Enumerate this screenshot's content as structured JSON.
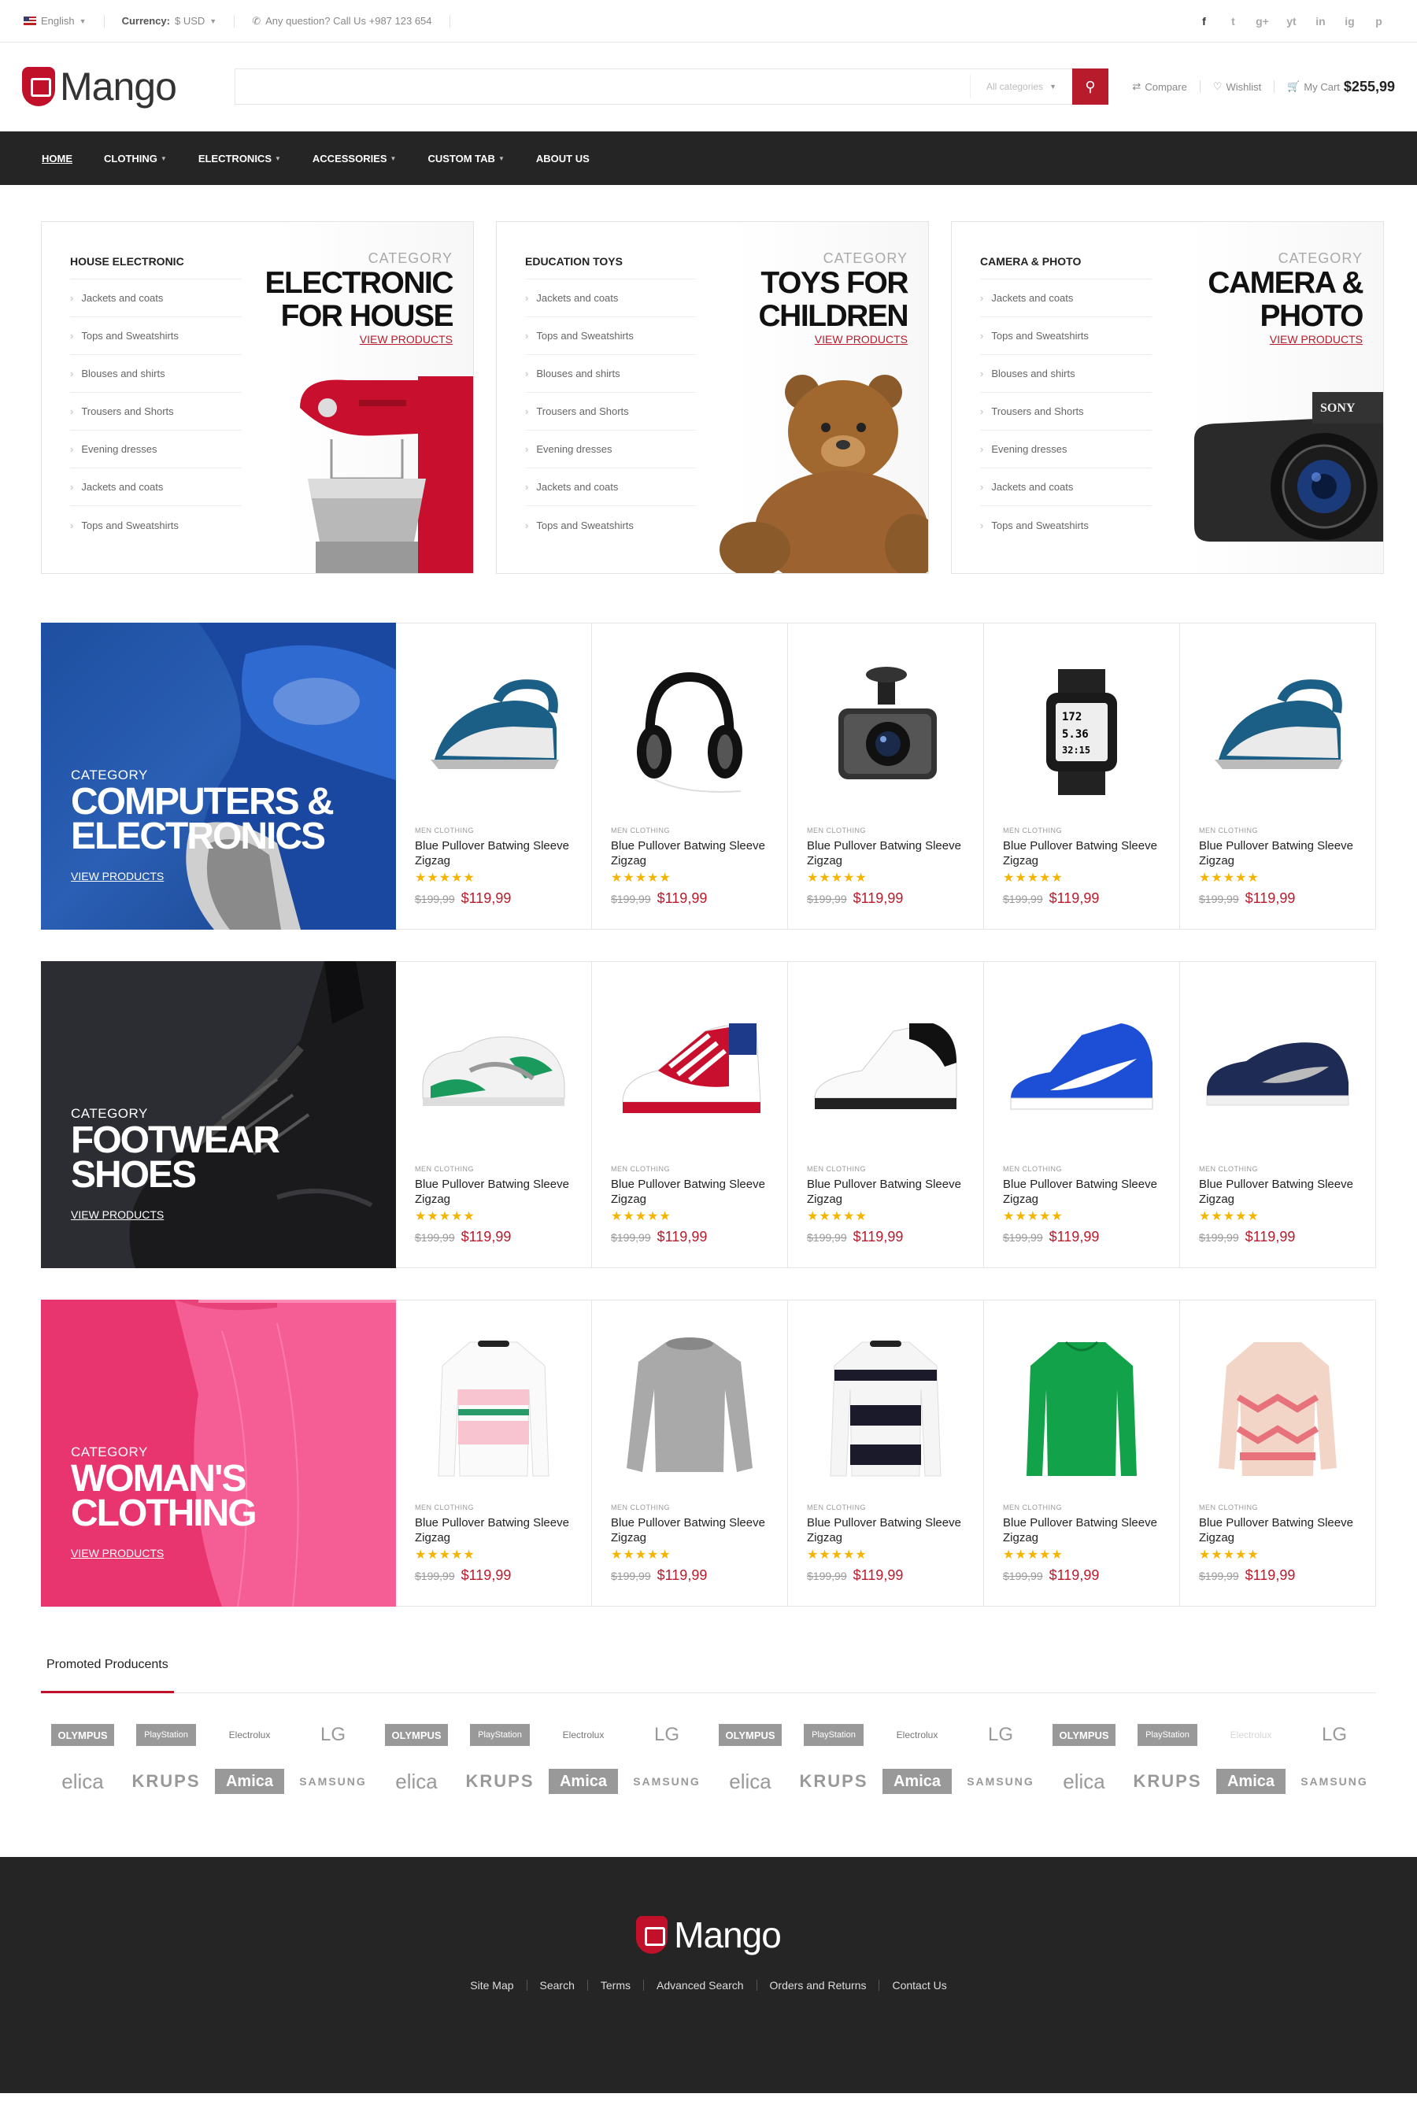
{
  "topbar": {
    "language": "English",
    "currency_label": "Currency:",
    "currency_value": "$ USD",
    "contact": "Any question? Call Us +987 123 654",
    "socials": [
      "f",
      "t",
      "g+",
      "yt",
      "in",
      "ig",
      "p"
    ]
  },
  "header": {
    "logo": "Mango",
    "search_placeholder": "",
    "category_select": "All categories",
    "compare": "Compare",
    "wishlist": "Wishlist",
    "cart_label": "My Cart",
    "cart_total": "$255,99"
  },
  "nav": [
    "HOME",
    "CLOTHING",
    "ELECTRONICS",
    "ACCESSORIES",
    "CUSTOM TAB",
    "ABOUT US"
  ],
  "category_boxes": [
    {
      "heading": "HOUSE ELECTRONIC",
      "label": "CATEGORY",
      "title": "ELECTRONIC FOR HOUSE",
      "link": "VIEW PRODUCTS",
      "items": [
        "Jackets and coats",
        "Tops and Sweatshirts",
        "Blouses and shirts",
        "Trousers and Shorts",
        "Evening dresses",
        "Jackets and coats",
        "Tops and Sweatshirts"
      ]
    },
    {
      "heading": "EDUCATION TOYS",
      "label": "CATEGORY",
      "title": "TOYS FOR CHILDREN",
      "link": "VIEW PRODUCTS",
      "items": [
        "Jackets and coats",
        "Tops and Sweatshirts",
        "Blouses and shirts",
        "Trousers and Shorts",
        "Evening dresses",
        "Jackets and coats",
        "Tops and Sweatshirts"
      ]
    },
    {
      "heading": "CAMERA & PHOTO",
      "label": "CATEGORY",
      "title": "CAMERA & PHOTO",
      "link": "VIEW PRODUCTS",
      "items": [
        "Jackets and coats",
        "Tops and Sweatshirts",
        "Blouses and shirts",
        "Trousers and Shorts",
        "Evening dresses",
        "Jackets and coats",
        "Tops and Sweatshirts"
      ]
    }
  ],
  "rows": [
    {
      "label": "CATEGORY",
      "title": "COMPUTERS & ELECTRONICS",
      "link": "VIEW PRODUCTS",
      "color": "#1e4fa0",
      "products": [
        {
          "cat": "MEN CLOTHING",
          "name": "Blue Pullover Batwing Sleeve Zigzag",
          "stars": "★★★★★",
          "old": "$199,99",
          "price": "$119,99",
          "icon": "iron"
        },
        {
          "cat": "MEN CLOTHING",
          "name": "Blue Pullover Batwing Sleeve Zigzag",
          "stars": "★★★★★",
          "old": "$199,99",
          "price": "$119,99",
          "icon": "headphones"
        },
        {
          "cat": "MEN CLOTHING",
          "name": "Blue Pullover Batwing Sleeve Zigzag",
          "stars": "★★★★★",
          "old": "$199,99",
          "price": "$119,99",
          "icon": "dashcam"
        },
        {
          "cat": "MEN CLOTHING",
          "name": "Blue Pullover Batwing Sleeve Zigzag",
          "stars": "★★★★★",
          "old": "$199,99",
          "price": "$119,99",
          "icon": "watch"
        },
        {
          "cat": "MEN CLOTHING",
          "name": "Blue Pullover Batwing Sleeve Zigzag",
          "stars": "★★★★★",
          "old": "$199,99",
          "price": "$119,99",
          "icon": "iron"
        }
      ]
    },
    {
      "label": "CATEGORY",
      "title": "FOOTWEAR SHOES",
      "link": "VIEW PRODUCTS",
      "color": "#2b2d33",
      "products": [
        {
          "cat": "MEN CLOTHING",
          "name": "Blue Pullover Batwing Sleeve Zigzag",
          "stars": "★★★★★",
          "old": "$199,99",
          "price": "$119,99",
          "icon": "shoe-green"
        },
        {
          "cat": "MEN CLOTHING",
          "name": "Blue Pullover Batwing Sleeve Zigzag",
          "stars": "★★★★★",
          "old": "$199,99",
          "price": "$119,99",
          "icon": "shoe-flag"
        },
        {
          "cat": "MEN CLOTHING",
          "name": "Blue Pullover Batwing Sleeve Zigzag",
          "stars": "★★★★★",
          "old": "$199,99",
          "price": "$119,99",
          "icon": "shoe-white"
        },
        {
          "cat": "MEN CLOTHING",
          "name": "Blue Pullover Batwing Sleeve Zigzag",
          "stars": "★★★★★",
          "old": "$199,99",
          "price": "$119,99",
          "icon": "shoe-blue"
        },
        {
          "cat": "MEN CLOTHING",
          "name": "Blue Pullover Batwing Sleeve Zigzag",
          "stars": "★★★★★",
          "old": "$199,99",
          "price": "$119,99",
          "icon": "shoe-navy"
        }
      ]
    },
    {
      "label": "CATEGORY",
      "title": "WOMAN'S CLOTHING",
      "link": "VIEW PRODUCTS",
      "color": "#e8346f",
      "products": [
        {
          "cat": "MEN CLOTHING",
          "name": "Blue Pullover Batwing Sleeve Zigzag",
          "stars": "★★★★★",
          "old": "$199,99",
          "price": "$119,99",
          "icon": "sweater-pink"
        },
        {
          "cat": "MEN CLOTHING",
          "name": "Blue Pullover Batwing Sleeve Zigzag",
          "stars": "★★★★★",
          "old": "$199,99",
          "price": "$119,99",
          "icon": "sweater-grey"
        },
        {
          "cat": "MEN CLOTHING",
          "name": "Blue Pullover Batwing Sleeve Zigzag",
          "stars": "★★★★★",
          "old": "$199,99",
          "price": "$119,99",
          "icon": "sweater-stripe"
        },
        {
          "cat": "MEN CLOTHING",
          "name": "Blue Pullover Batwing Sleeve Zigzag",
          "stars": "★★★★★",
          "old": "$199,99",
          "price": "$119,99",
          "icon": "sweater-green"
        },
        {
          "cat": "MEN CLOTHING",
          "name": "Blue Pullover Batwing Sleeve Zigzag",
          "stars": "★★★★★",
          "old": "$199,99",
          "price": "$119,99",
          "icon": "sweater-pattern"
        }
      ]
    }
  ],
  "promoted": {
    "title": "Promoted Producents",
    "brands_row1": [
      "OLYMPUS",
      "PlayStation",
      "Electrolux",
      "LG",
      "OLYMPUS",
      "PlayStation",
      "Electrolux",
      "LG",
      "OLYMPUS",
      "PlayStation",
      "Electrolux",
      "LG",
      "OLYMPUS",
      "PlayStation",
      "Electrolux",
      "LG"
    ],
    "brands_row2": [
      "elica",
      "KRUPS",
      "Amica",
      "SAMSUNG",
      "elica",
      "KRUPS",
      "Amica",
      "SAMSUNG",
      "elica",
      "KRUPS",
      "Amica",
      "SAMSUNG",
      "elica",
      "KRUPS",
      "Amica",
      "SAMSUNG"
    ]
  },
  "footer": {
    "logo": "Mango",
    "links": [
      "Site Map",
      "Search",
      "Terms",
      "Advanced Search",
      "Orders and Returns",
      "Contact Us"
    ]
  },
  "colors": {
    "accent": "#b81b2b",
    "dark": "#252525",
    "star": "#f4b400"
  }
}
